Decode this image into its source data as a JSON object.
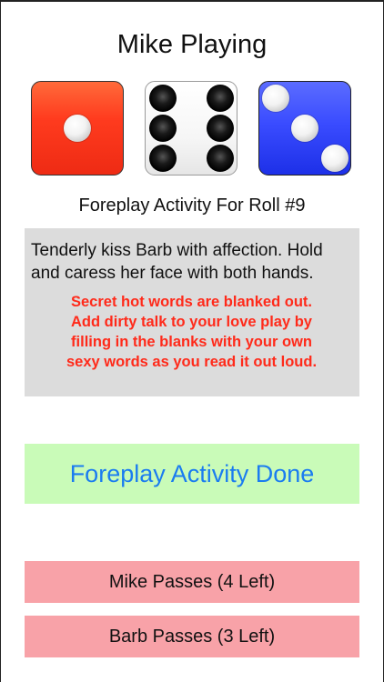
{
  "header": {
    "title": "Mike Playing"
  },
  "dice": [
    {
      "name": "red-die",
      "value": 1,
      "color": "#ff3b1e"
    },
    {
      "name": "white-die",
      "value": 6,
      "color": "#f6f6f6"
    },
    {
      "name": "blue-die",
      "value": 3,
      "color": "#3a4cff"
    }
  ],
  "roll": {
    "label": "Foreplay Activity For Roll #9"
  },
  "activity": {
    "text": "Tenderly kiss Barb with affection. Hold and caress her face with both hands.",
    "secret_note": "Secret hot words are blanked out.\nAdd dirty talk to your love play by\nfilling in the blanks with your own\nsexy words as you read it out loud."
  },
  "buttons": {
    "done_label": "Foreplay Activity Done",
    "mike_pass_label": "Mike Passes (4 Left)",
    "barb_pass_label": "Barb Passes (3 Left)"
  },
  "colors": {
    "done_bg": "#c9fbb8",
    "done_text": "#1a7cf0",
    "pass_bg": "#f8a2a8",
    "secret_text": "#ff2a1a",
    "activity_bg": "#dcdcdc"
  }
}
